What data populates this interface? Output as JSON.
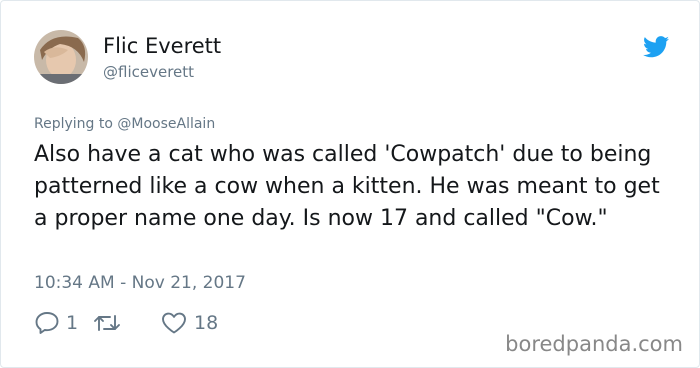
{
  "author": {
    "display_name": "Flic Everett",
    "handle": "@fliceverett"
  },
  "replying_to": "Replying to @MooseAllain",
  "tweet_text": "Also have a cat who was called 'Cowpatch' due to being patterned like a cow when a kitten. He was meant to get a proper name one day. Is now 17 and called \"Cow.\"",
  "timestamp": "10:34 AM - Nov 21, 2017",
  "actions": {
    "reply_count": "1",
    "retweet_count": "",
    "like_count": "18"
  },
  "watermark": "boredpanda.com",
  "colors": {
    "twitter_blue": "#1da1f2",
    "secondary_text": "#657786"
  }
}
